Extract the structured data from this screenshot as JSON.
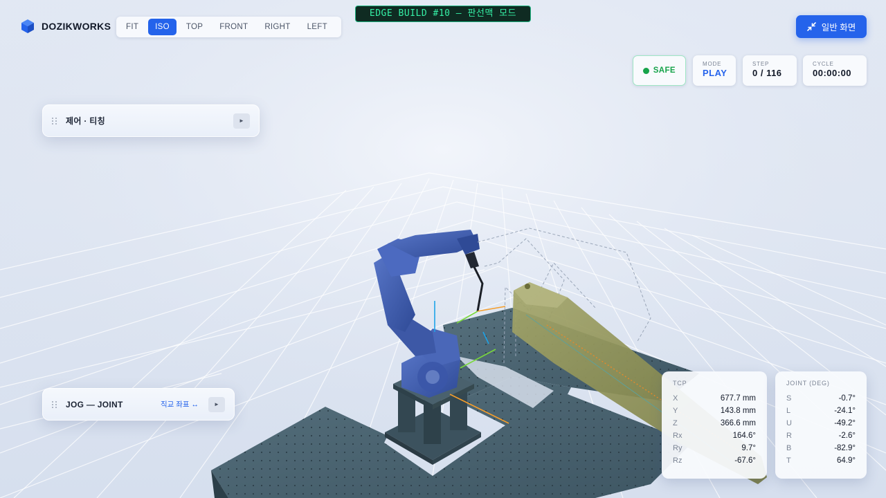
{
  "brand": {
    "name": "DOZIKWORKS",
    "logo_icon": "cube-icon",
    "logo_color": "#2563eb"
  },
  "view_tabs": [
    {
      "label": "FIT",
      "active": false
    },
    {
      "label": "ISO",
      "active": true
    },
    {
      "label": "TOP",
      "active": false
    },
    {
      "label": "FRONT",
      "active": false
    },
    {
      "label": "RIGHT",
      "active": false
    },
    {
      "label": "LEFT",
      "active": false
    }
  ],
  "build_badge": "EDGE BUILD #10 — 판선맥 모드",
  "normal_view_button": {
    "label": "일반 화면",
    "icon": "collapse-icon"
  },
  "status": {
    "safe": {
      "label": "SAFE",
      "color": "#16a34a"
    },
    "mode": {
      "label": "MODE",
      "value": "PLAY"
    },
    "step": {
      "label": "STEP",
      "value": "0 / 116"
    },
    "cycle": {
      "label": "CYCLE",
      "value": "00:00:00"
    }
  },
  "control_panel": {
    "title": "제어 · 티칭",
    "play_icon": "►"
  },
  "jog_panel": {
    "title": "JOG — JOINT",
    "coord_toggle": "직교 좌표 ↔",
    "play_icon": "►"
  },
  "tcp": {
    "title": "TCP",
    "rows": [
      {
        "k": "X",
        "v": "677.7 mm"
      },
      {
        "k": "Y",
        "v": "143.8 mm"
      },
      {
        "k": "Z",
        "v": "366.6 mm"
      },
      {
        "k": "Rx",
        "v": "164.6°"
      },
      {
        "k": "Ry",
        "v": "9.7°"
      },
      {
        "k": "Rz",
        "v": "-67.6°"
      }
    ]
  },
  "joint": {
    "title": "JOINT (DEG)",
    "rows": [
      {
        "k": "S",
        "v": "-0.7°"
      },
      {
        "k": "L",
        "v": "-24.1°"
      },
      {
        "k": "U",
        "v": "-49.2°"
      },
      {
        "k": "R",
        "v": "-2.6°"
      },
      {
        "k": "B",
        "v": "-82.9°"
      },
      {
        "k": "T",
        "v": "64.9°"
      }
    ]
  },
  "scene_colors": {
    "robot": "#3f5eb0",
    "table": "#4a6472",
    "workpiece": "#8c8f52",
    "grid_line": "#ffffff"
  }
}
